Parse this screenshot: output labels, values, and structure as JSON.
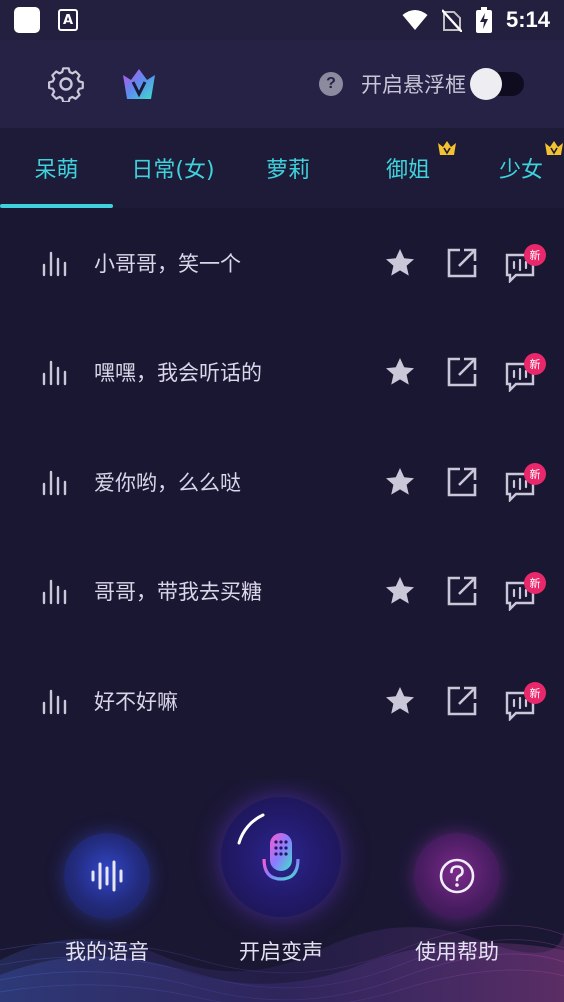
{
  "status_bar": {
    "time": "5:14",
    "notification_icon": "A"
  },
  "header": {
    "settings_icon": "gear-icon",
    "vip_icon": "vip-crown-icon",
    "help_icon": "?",
    "floating_window_label": "开启悬浮框",
    "floating_window_enabled": false
  },
  "tabs": [
    {
      "label": "呆萌",
      "selected": true,
      "vip": false
    },
    {
      "label": "日常(女)",
      "selected": false,
      "vip": false
    },
    {
      "label": "萝莉",
      "selected": false,
      "vip": false
    },
    {
      "label": "御姐",
      "selected": false,
      "vip": true
    },
    {
      "label": "少女",
      "selected": false,
      "vip": true
    }
  ],
  "voice_items": [
    {
      "text": "小哥哥，笑一个",
      "badge": "新"
    },
    {
      "text": "嘿嘿，我会听话的",
      "badge": "新"
    },
    {
      "text": "爱你哟，么么哒",
      "badge": "新"
    },
    {
      "text": "哥哥，带我去买糖",
      "badge": "新"
    },
    {
      "text": "好不好嘛",
      "badge": "新"
    }
  ],
  "bottom_bar": {
    "my_voice_label": "我的语音",
    "start_change_label": "开启变声",
    "help_label": "使用帮助"
  },
  "colors": {
    "accent": "#3fd2dc",
    "background": "#1a1733",
    "badge": "#e8286b"
  }
}
